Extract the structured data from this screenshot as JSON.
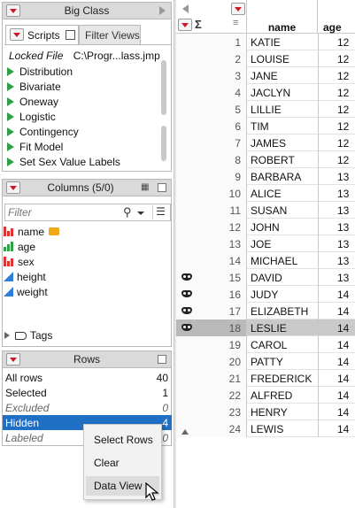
{
  "table": {
    "title": "Big Class",
    "tabs": [
      "Scripts",
      "Filter Views"
    ],
    "locked_file_label": "Locked File",
    "locked_file_path": "C:\\Progr...lass.jmp",
    "scripts": [
      "Distribution",
      "Bivariate",
      "Oneway",
      "Logistic",
      "Contingency",
      "Fit Model",
      "Set Sex Value Labels"
    ]
  },
  "columns": {
    "header": "Columns (5/0)",
    "filter_placeholder": "Filter",
    "items": [
      {
        "name": "name",
        "type": "nominal",
        "label_flag": true
      },
      {
        "name": "age",
        "type": "ordinal"
      },
      {
        "name": "sex",
        "type": "nominal"
      },
      {
        "name": "height",
        "type": "continuous"
      },
      {
        "name": "weight",
        "type": "continuous"
      }
    ],
    "tags_label": "Tags"
  },
  "rows_panel": {
    "header": "Rows",
    "items": [
      {
        "label": "All rows",
        "value": "40"
      },
      {
        "label": "Selected",
        "value": "1"
      },
      {
        "label": "Excluded",
        "value": "0"
      },
      {
        "label": "Hidden",
        "value": "4"
      },
      {
        "label": "Labeled",
        "value": "0"
      }
    ]
  },
  "context_menu": {
    "items": [
      "Select Rows",
      "Clear",
      "Data View"
    ],
    "hovered": "Data View"
  },
  "grid": {
    "col_headers": [
      "name",
      "age"
    ],
    "rows": [
      {
        "n": "1",
        "name": "KATIE",
        "age": "12"
      },
      {
        "n": "2",
        "name": "LOUISE",
        "age": "12"
      },
      {
        "n": "3",
        "name": "JANE",
        "age": "12"
      },
      {
        "n": "4",
        "name": "JACLYN",
        "age": "12"
      },
      {
        "n": "5",
        "name": "LILLIE",
        "age": "12"
      },
      {
        "n": "6",
        "name": "TIM",
        "age": "12"
      },
      {
        "n": "7",
        "name": "JAMES",
        "age": "12"
      },
      {
        "n": "8",
        "name": "ROBERT",
        "age": "12"
      },
      {
        "n": "9",
        "name": "BARBARA",
        "age": "13"
      },
      {
        "n": "10",
        "name": "ALICE",
        "age": "13"
      },
      {
        "n": "11",
        "name": "SUSAN",
        "age": "13"
      },
      {
        "n": "12",
        "name": "JOHN",
        "age": "13"
      },
      {
        "n": "13",
        "name": "JOE",
        "age": "13"
      },
      {
        "n": "14",
        "name": "MICHAEL",
        "age": "13"
      },
      {
        "n": "15",
        "name": "DAVID",
        "age": "13",
        "hidden": true
      },
      {
        "n": "16",
        "name": "JUDY",
        "age": "14",
        "hidden": true
      },
      {
        "n": "17",
        "name": "ELIZABETH",
        "age": "14",
        "hidden": true
      },
      {
        "n": "18",
        "name": "LESLIE",
        "age": "14",
        "hidden": true,
        "selected": true
      },
      {
        "n": "19",
        "name": "CAROL",
        "age": "14"
      },
      {
        "n": "20",
        "name": "PATTY",
        "age": "14"
      },
      {
        "n": "21",
        "name": "FREDERICK",
        "age": "14"
      },
      {
        "n": "22",
        "name": "ALFRED",
        "age": "14"
      },
      {
        "n": "23",
        "name": "HENRY",
        "age": "14"
      },
      {
        "n": "24",
        "name": "LEWIS",
        "age": "14"
      }
    ]
  },
  "colors": {
    "hot_triangle": "#d0182a",
    "selection_blue": "#1f6fc5",
    "selected_row_gray": "#c9c9c9",
    "nominal_red": "#d33333",
    "ordinal_green": "#2fa046",
    "continuous_blue": "#2f7fd8",
    "label_tag_orange": "#f0a818"
  }
}
